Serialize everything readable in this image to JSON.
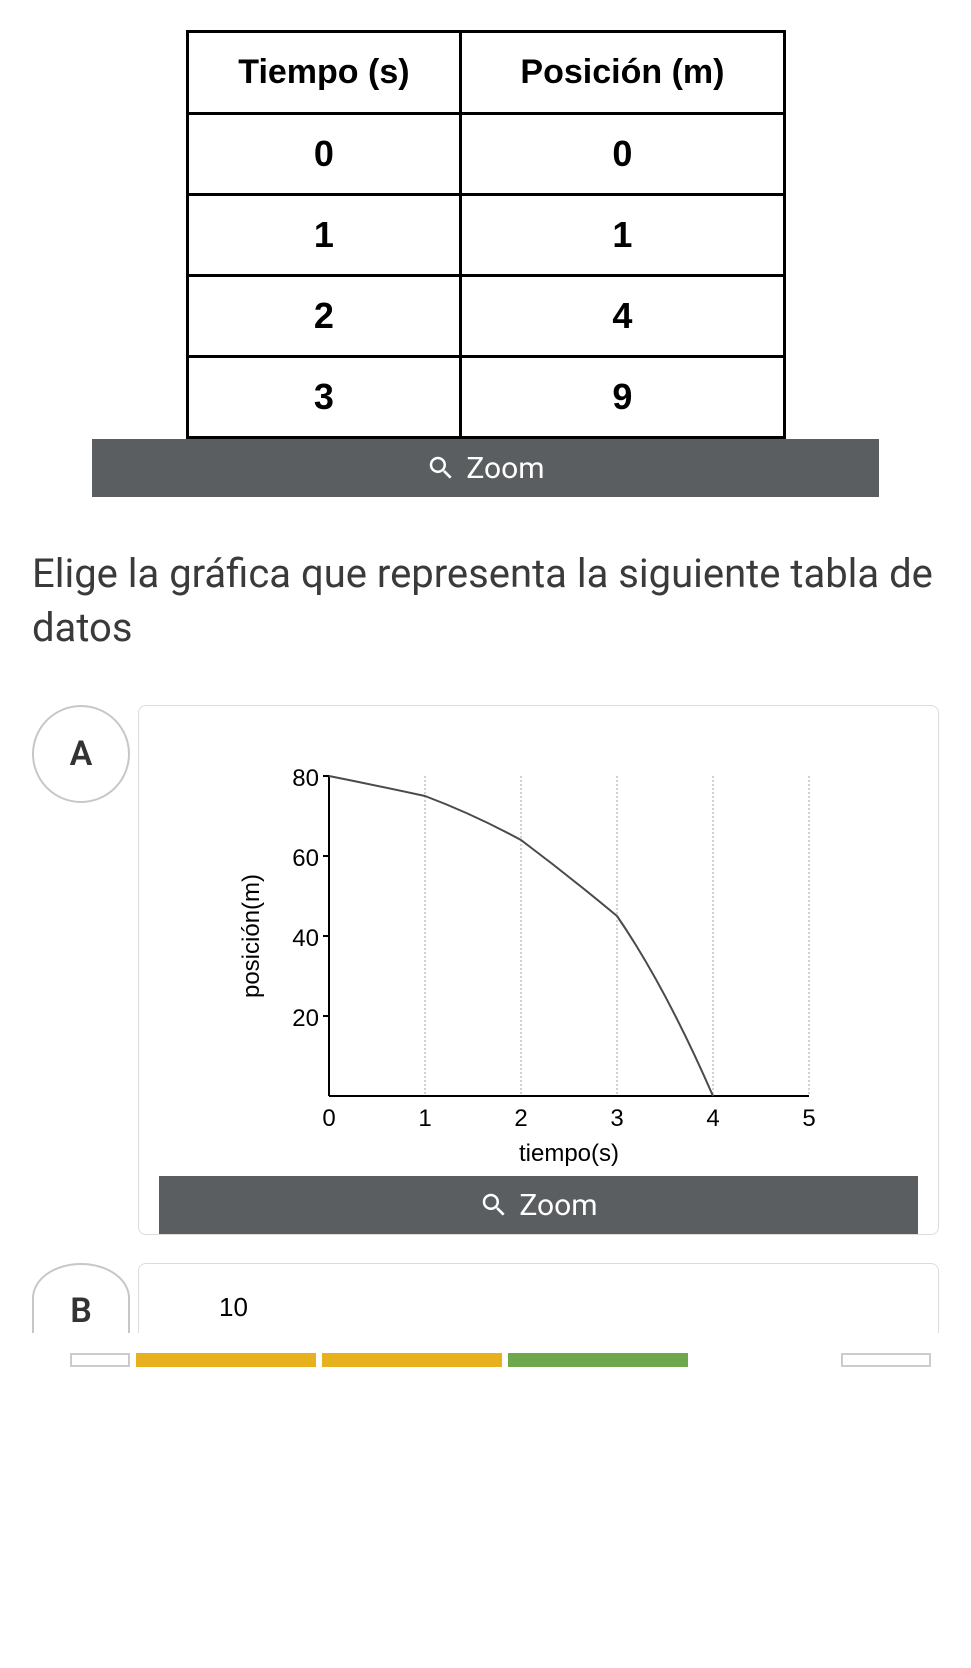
{
  "table": {
    "headers": [
      "Tiempo (s)",
      "Posición (m)"
    ],
    "rows": [
      [
        "0",
        "0"
      ],
      [
        "1",
        "1"
      ],
      [
        "2",
        "4"
      ],
      [
        "3",
        "9"
      ]
    ]
  },
  "zoom_label": "Zoom",
  "question": "Elige la gráfica que representa la siguiente tabla de datos",
  "options": {
    "a": {
      "label": "A"
    },
    "b": {
      "label": "B",
      "partial_value": "10"
    }
  },
  "chart_data": {
    "type": "line",
    "title": "",
    "xlabel": "tiempo(s)",
    "ylabel": "posición(m)",
    "xlim": [
      0,
      5
    ],
    "ylim": [
      0,
      80
    ],
    "x_ticks": [
      0,
      1,
      2,
      3,
      4,
      5
    ],
    "y_ticks": [
      20,
      40,
      60,
      80
    ],
    "series": [
      {
        "name": "posición",
        "x": [
          0,
          1,
          2,
          3,
          4
        ],
        "y": [
          80,
          75,
          64,
          45,
          0
        ]
      }
    ]
  }
}
